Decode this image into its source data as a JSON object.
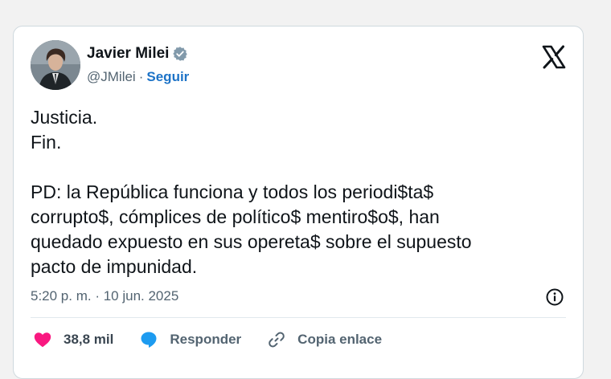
{
  "author": {
    "name": "Javier Milei",
    "handle": "@JMilei",
    "separator": "·",
    "follow_label": "Seguir"
  },
  "icons": {
    "verified": "verified-badge-icon",
    "platform": "x-logo-icon",
    "info": "info-icon",
    "like": "heart-icon",
    "reply": "speech-bubble-icon",
    "copy_link": "link-icon"
  },
  "tweet": {
    "lines": [
      "Justicia.",
      "Fin.",
      "",
      "PD: la República funciona y todos los periodi$ta$",
      "corrupto$, cómplices de político$ mentiro$o$, han",
      "quedado expuesto en sus opereta$ sobre el supuesto",
      "pacto de impunidad."
    ],
    "timestamp": "5:20 p. m. · 10 jun. 2025"
  },
  "actions": {
    "likes": "38,8 mil",
    "reply_label": "Responder",
    "copy_label": "Copia enlace"
  },
  "colors": {
    "background": "#f2f2f2",
    "card": "#ffffff",
    "border": "#cfd9de",
    "follow": "#1d73c7",
    "verified": "#829aab",
    "heart": "#f91880",
    "reply": "#1d9bf0",
    "muted": "#536471"
  }
}
